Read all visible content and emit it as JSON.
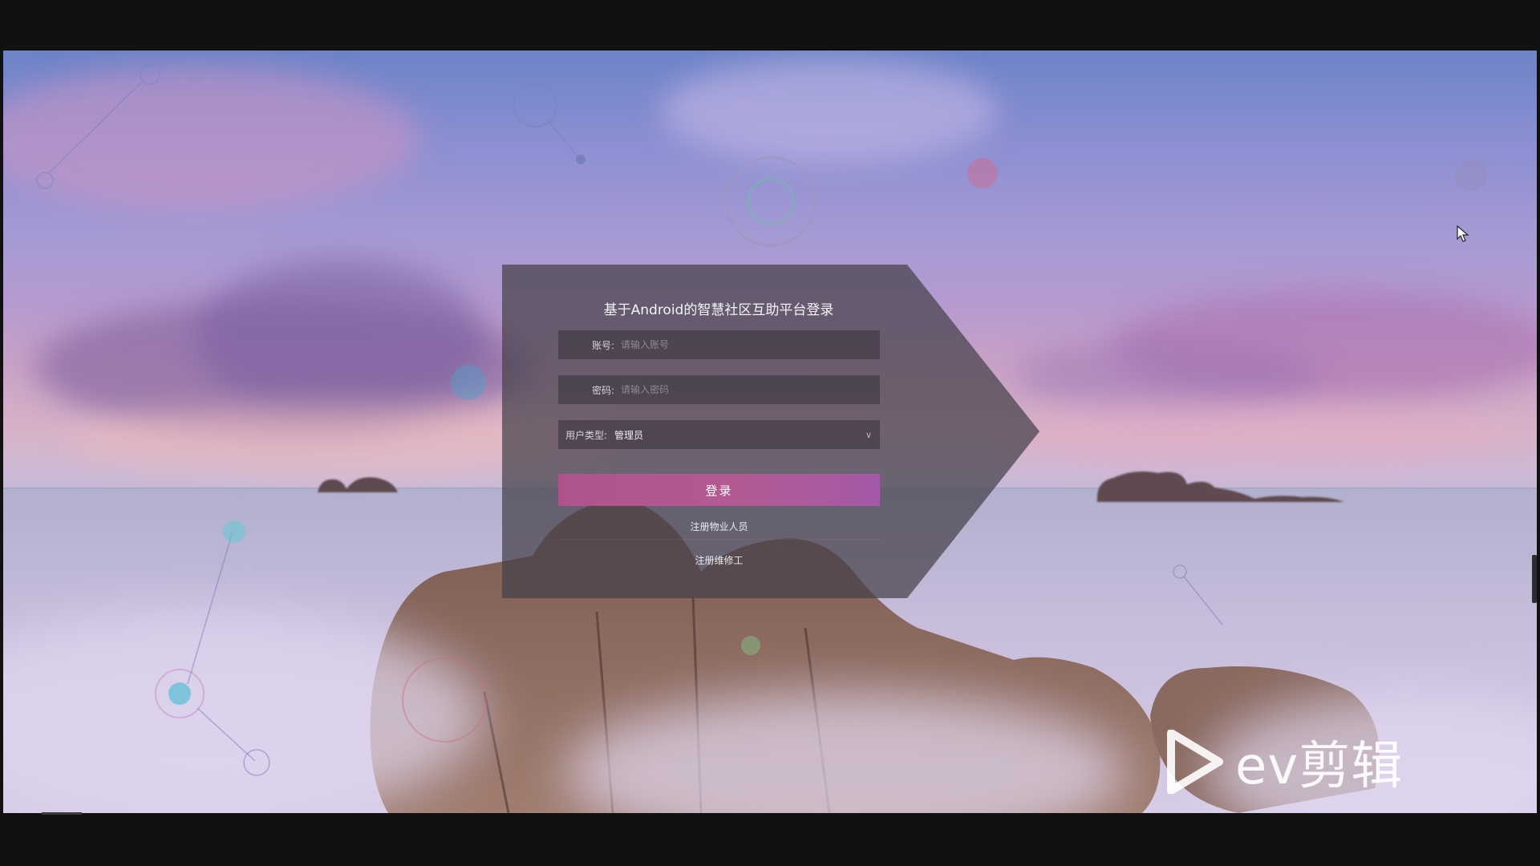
{
  "login": {
    "title": "基于Android的智慧社区互助平台登录",
    "account_label": "账号:",
    "account_placeholder": "请输入账号",
    "password_label": "密码:",
    "password_placeholder": "请输入密码",
    "user_type_label": "用户类型:",
    "user_type_value": "管理员",
    "login_button": "登录",
    "register_property_link": "注册物业人员",
    "register_repair_link": "注册维修工"
  },
  "watermark": {
    "text": "ev剪辑"
  },
  "colors": {
    "login_button": "#b0538c",
    "panel": "#46414b"
  },
  "icons": [
    "chevron-down-icon",
    "play-logo-icon",
    "cursor-icon"
  ]
}
